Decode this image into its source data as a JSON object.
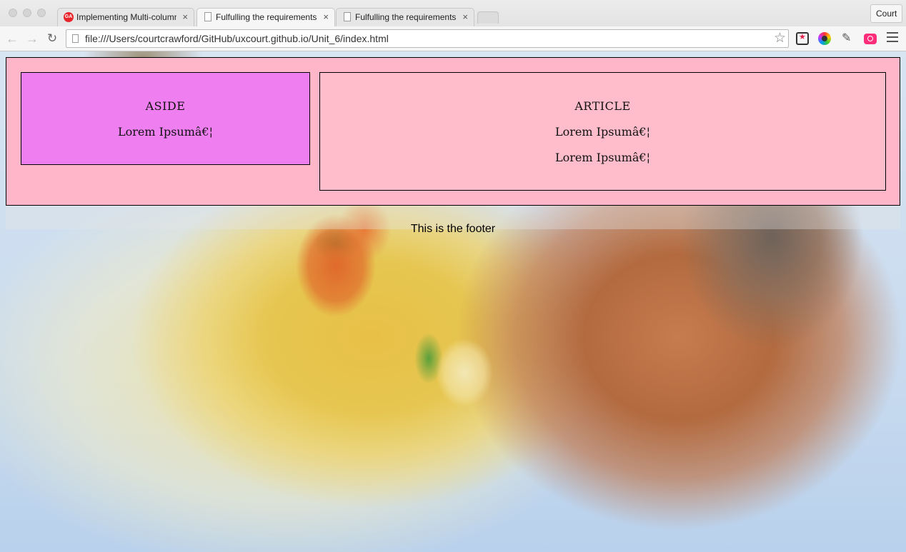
{
  "tabs": [
    {
      "label": "Implementing Multi-column",
      "favicon": "ga-logo-icon",
      "active": false
    },
    {
      "label": "Fulfulling the requirements",
      "favicon": "document-icon",
      "active": true
    },
    {
      "label": "Fulfulling the requirements",
      "favicon": "document-icon",
      "active": false
    }
  ],
  "tab_close_glyph": "×",
  "profile": "Court",
  "toolbar": {
    "url": "file:///Users/courtcrawford/GitHub/uxcourt.github.io/Unit_6/index.html"
  },
  "page": {
    "aside": {
      "heading": "ASIDE",
      "paragraphs": [
        "Lorem Ipsumâ€¦"
      ]
    },
    "article": {
      "heading": "ARTICLE",
      "paragraphs": [
        "Lorem Ipsumâ€¦",
        "Lorem Ipsumâ€¦"
      ]
    },
    "footer": "This is the footer"
  },
  "colors": {
    "wrapper_bg": "#ffb6c9",
    "aside_bg": "#ef7ff0",
    "article_bg": "#ffbccb",
    "camera_ext": "#ff2d7a"
  }
}
